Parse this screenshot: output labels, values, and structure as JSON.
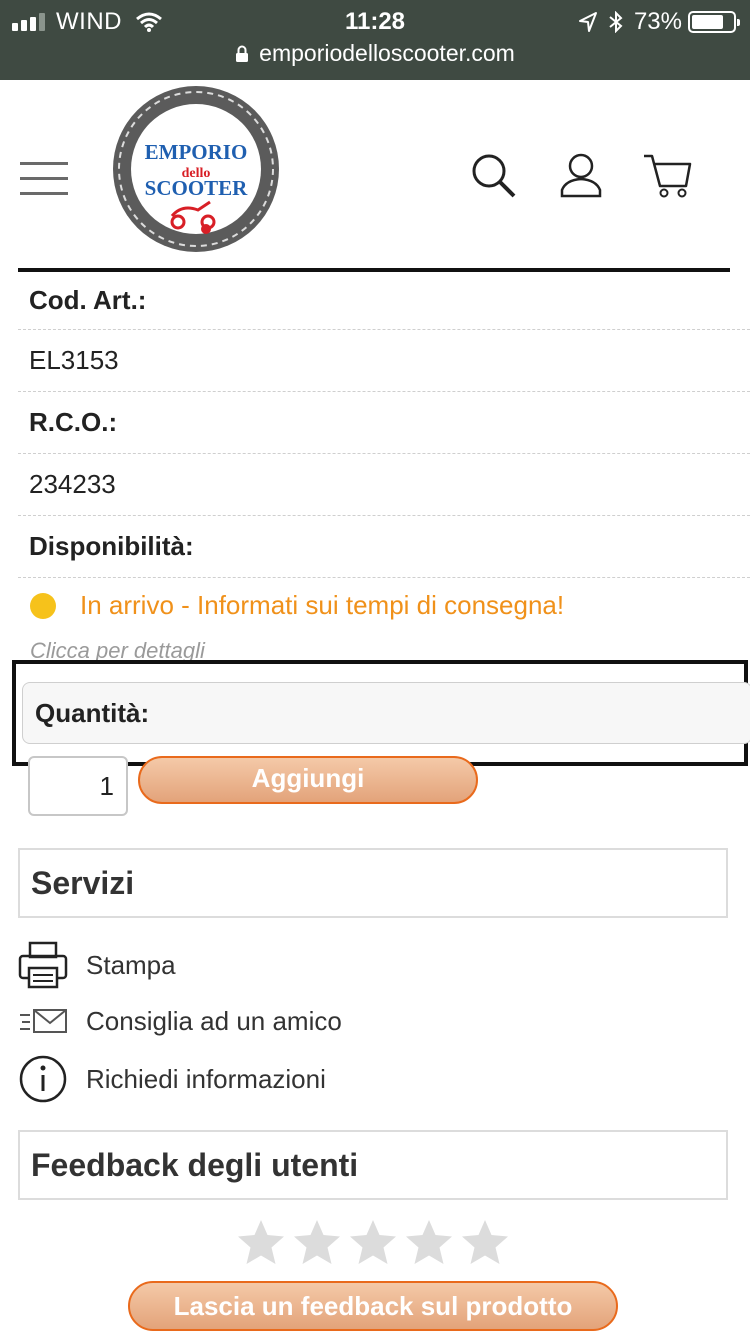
{
  "status_bar": {
    "carrier": "WIND",
    "time": "11:28",
    "battery_percent": "73%",
    "battery_level": 0.73,
    "url": "emporiodelloscooter.com"
  },
  "header": {
    "logo_text_top": "EMPORIO",
    "logo_text_mid": "dello",
    "logo_text_bottom": "SCOOTER",
    "icons": [
      "menu-icon",
      "search-icon",
      "user-icon",
      "cart-icon"
    ]
  },
  "product": {
    "code_label": "Cod. Art.:",
    "code_value": "EL3153",
    "rco_label": "R.C.O.:",
    "rco_value": "234233",
    "availability_label": "Disponibilità:",
    "availability_text": "In arrivo - Informati sui tempi di consegna!",
    "availability_color": "#f0911a",
    "details_text": "Clicca per dettagli",
    "quantity_label": "Quantità:",
    "quantity_value": "1",
    "add_button": "Aggiungi"
  },
  "services": {
    "title": "Servizi",
    "items": [
      {
        "label": "Stampa",
        "icon": "printer-icon"
      },
      {
        "label": "Consiglia ad un amico",
        "icon": "send-mail-icon"
      },
      {
        "label": "Richiedi informazioni",
        "icon": "info-icon"
      }
    ]
  },
  "feedback": {
    "title": "Feedback degli utenti",
    "rating": 0,
    "max_rating": 5,
    "button": "Lascia un feedback sul prodotto"
  },
  "colors": {
    "accent_orange": "#e96a1c",
    "status_bar_bg": "#3f4a42",
    "availability_dot": "#f6c21b"
  }
}
